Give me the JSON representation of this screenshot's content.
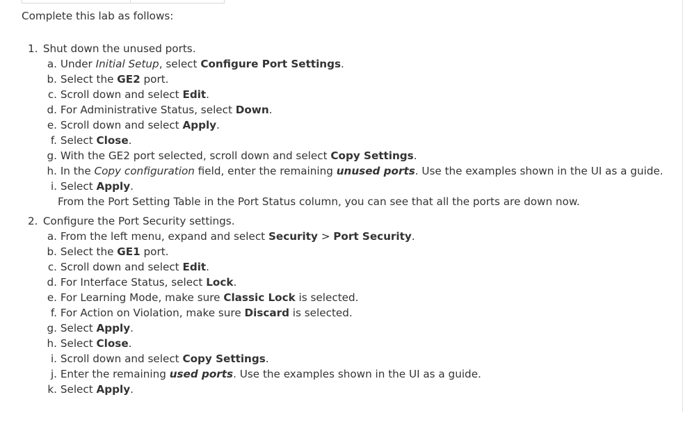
{
  "intro": "Complete this lab as follows:",
  "steps": [
    {
      "num": "1.",
      "text": "Shut down the unused ports.",
      "substeps": [
        {
          "letter": "a.",
          "parts": [
            {
              "t": "Under "
            },
            {
              "t": "Initial Setup",
              "s": "i"
            },
            {
              "t": ", select "
            },
            {
              "t": "Configure Port Settings",
              "s": "b"
            },
            {
              "t": "."
            }
          ]
        },
        {
          "letter": "b.",
          "parts": [
            {
              "t": "Select the "
            },
            {
              "t": "GE2",
              "s": "b"
            },
            {
              "t": " port."
            }
          ]
        },
        {
          "letter": "c.",
          "parts": [
            {
              "t": "Scroll down and select "
            },
            {
              "t": "Edit",
              "s": "b"
            },
            {
              "t": "."
            }
          ]
        },
        {
          "letter": "d.",
          "parts": [
            {
              "t": "For Administrative Status, select "
            },
            {
              "t": "Down",
              "s": "b"
            },
            {
              "t": "."
            }
          ]
        },
        {
          "letter": "e.",
          "parts": [
            {
              "t": "Scroll down and select "
            },
            {
              "t": "Apply",
              "s": "b"
            },
            {
              "t": "."
            }
          ]
        },
        {
          "letter": "f.",
          "parts": [
            {
              "t": "Select "
            },
            {
              "t": "Close",
              "s": "b"
            },
            {
              "t": "."
            }
          ]
        },
        {
          "letter": "g.",
          "parts": [
            {
              "t": "With the GE2 port selected, scroll down and select "
            },
            {
              "t": "Copy Settings",
              "s": "b"
            },
            {
              "t": "."
            }
          ]
        },
        {
          "letter": "h.",
          "parts": [
            {
              "t": "In the "
            },
            {
              "t": "Copy configuration",
              "s": "i"
            },
            {
              "t": " field, enter the remaining "
            },
            {
              "t": "unused ports",
              "s": "bi"
            },
            {
              "t": ". Use the examples shown in the UI as a guide."
            }
          ]
        },
        {
          "letter": "i.",
          "parts": [
            {
              "t": "Select "
            },
            {
              "t": "Apply",
              "s": "b"
            },
            {
              "t": "."
            }
          ]
        }
      ],
      "note": "From the Port Setting Table in the Port Status column, you can see that all the ports are down now."
    },
    {
      "num": "2.",
      "text": "Configure the Port Security settings.",
      "substeps": [
        {
          "letter": "a.",
          "parts": [
            {
              "t": "From the left menu, expand and select "
            },
            {
              "t": "Security",
              "s": "b"
            },
            {
              "t": " > "
            },
            {
              "t": "Port Security",
              "s": "b"
            },
            {
              "t": "."
            }
          ]
        },
        {
          "letter": "b.",
          "parts": [
            {
              "t": "Select the "
            },
            {
              "t": "GE1",
              "s": "b"
            },
            {
              "t": " port."
            }
          ]
        },
        {
          "letter": "c.",
          "parts": [
            {
              "t": "Scroll down and select "
            },
            {
              "t": "Edit",
              "s": "b"
            },
            {
              "t": "."
            }
          ]
        },
        {
          "letter": "d.",
          "parts": [
            {
              "t": "For Interface Status, select "
            },
            {
              "t": "Lock",
              "s": "b"
            },
            {
              "t": "."
            }
          ]
        },
        {
          "letter": "e.",
          "parts": [
            {
              "t": "For Learning Mode, make sure "
            },
            {
              "t": "Classic Lock",
              "s": "b"
            },
            {
              "t": " is selected."
            }
          ]
        },
        {
          "letter": "f.",
          "parts": [
            {
              "t": "For Action on Violation, make sure "
            },
            {
              "t": "Discard",
              "s": "b"
            },
            {
              "t": " is selected."
            }
          ]
        },
        {
          "letter": "g.",
          "parts": [
            {
              "t": "Select "
            },
            {
              "t": "Apply",
              "s": "b"
            },
            {
              "t": "."
            }
          ]
        },
        {
          "letter": "h.",
          "parts": [
            {
              "t": "Select "
            },
            {
              "t": "Close",
              "s": "b"
            },
            {
              "t": "."
            }
          ]
        },
        {
          "letter": "i.",
          "parts": [
            {
              "t": "Scroll down and select "
            },
            {
              "t": "Copy Settings",
              "s": "b"
            },
            {
              "t": "."
            }
          ]
        },
        {
          "letter": "j.",
          "parts": [
            {
              "t": "Enter the remaining "
            },
            {
              "t": "used ports",
              "s": "bi"
            },
            {
              "t": ". Use the examples shown in the UI as a guide."
            }
          ]
        },
        {
          "letter": "k.",
          "parts": [
            {
              "t": "Select "
            },
            {
              "t": "Apply",
              "s": "b"
            },
            {
              "t": "."
            }
          ]
        }
      ]
    }
  ]
}
